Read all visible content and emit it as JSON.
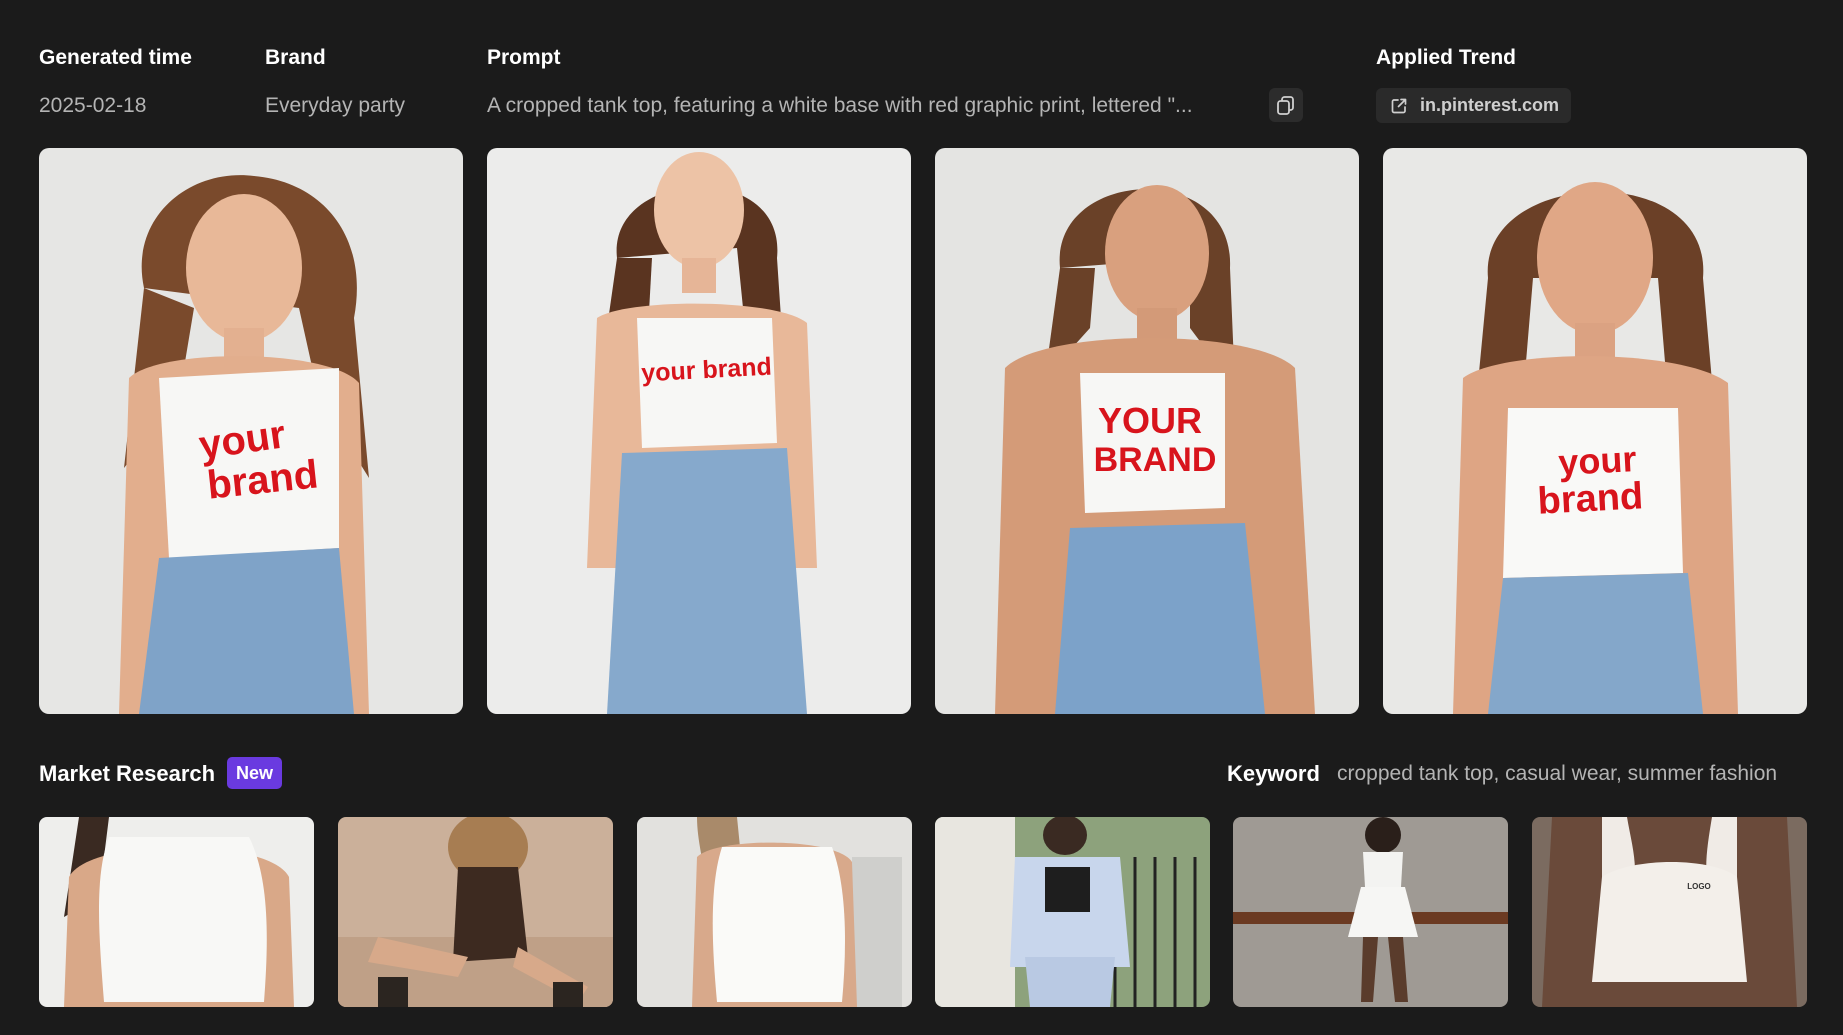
{
  "header": {
    "generated_time_label": "Generated time",
    "generated_time_value": "2025-02-18",
    "brand_label": "Brand",
    "brand_value": "Everyday party",
    "prompt_label": "Prompt",
    "prompt_value": "A cropped tank top, featuring a white base with red graphic print, lettered \"...",
    "copy_icon": "copy-icon",
    "applied_trend_label": "Applied Trend",
    "applied_trend_link": "in.pinterest.com",
    "external_link_icon": "external-link-icon"
  },
  "generated_images": [
    {
      "print_lines": [
        "your",
        "brand"
      ]
    },
    {
      "print_lines": [
        "your brand"
      ]
    },
    {
      "print_lines": [
        "YOUR",
        "BRAND"
      ]
    },
    {
      "print_lines": [
        "your",
        "brand"
      ]
    }
  ],
  "market_research": {
    "title": "Market Research",
    "badge": "New",
    "keyword_label": "Keyword",
    "keyword_value": "cropped tank top, casual wear, summer fashion",
    "items": [
      {
        "logo_text": ""
      },
      {
        "logo_text": ""
      },
      {
        "logo_text": ""
      },
      {
        "logo_text": ""
      },
      {
        "logo_text": ""
      },
      {
        "logo_text": "LOGO"
      }
    ]
  },
  "colors": {
    "background": "#1b1b1b",
    "accent_badge": "#6a3ae0",
    "print_red": "#d8141c",
    "denim": "#7fa3c8"
  }
}
